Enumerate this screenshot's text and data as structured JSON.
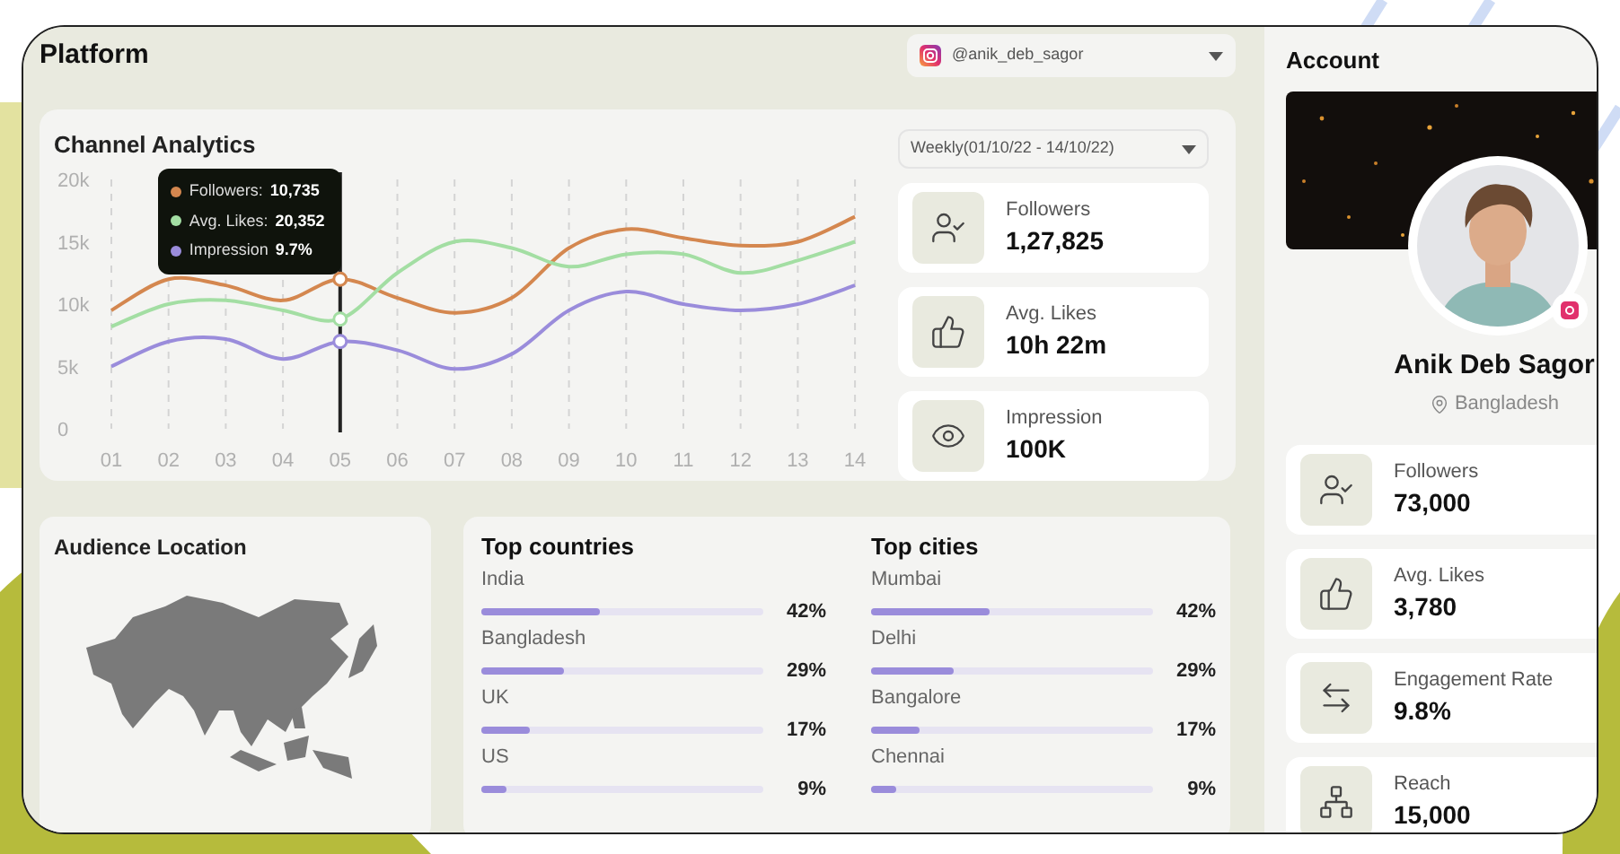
{
  "platform": {
    "title": "Platform",
    "account_select": {
      "value": "@anik_deb_sagor"
    }
  },
  "channel_analytics": {
    "title": "Channel Analytics",
    "period_select": {
      "value": "Weekly(01/10/22 - 14/10/22)"
    },
    "chart_data": {
      "type": "line",
      "grid": true,
      "ref_lines": [
        {
          "axis": "x",
          "value": "05",
          "color": "#222222"
        }
      ],
      "categories": [
        "01",
        "02",
        "03",
        "04",
        "05",
        "06",
        "07",
        "08",
        "09",
        "10",
        "11",
        "12",
        "13",
        "14"
      ],
      "ylim": [
        0,
        20000
      ],
      "yticks": [
        {
          "value": 0,
          "label": "0"
        },
        {
          "value": 5000,
          "label": "5k"
        },
        {
          "value": 10000,
          "label": "10k"
        },
        {
          "value": 15000,
          "label": "15k"
        },
        {
          "value": 20000,
          "label": "20k"
        }
      ],
      "series": [
        {
          "name": "Followers:",
          "color": "#d4874f",
          "values": [
            9500,
            12000,
            11500,
            10300,
            12000,
            10500,
            9300,
            10500,
            14500,
            16000,
            15300,
            14700,
            15000,
            17000
          ]
        },
        {
          "name": "Avg. Likes:",
          "color": "#a3dea3",
          "values": [
            8200,
            10000,
            10300,
            9500,
            8800,
            12500,
            15000,
            14500,
            13000,
            14000,
            14000,
            12500,
            13500,
            15000
          ]
        },
        {
          "name": "Impression",
          "color": "#9a8cdb",
          "values": [
            5000,
            7000,
            7200,
            5600,
            7000,
            6300,
            4800,
            6000,
            9500,
            11000,
            10000,
            9500,
            10000,
            11500
          ]
        }
      ]
    },
    "tooltip": {
      "values": [
        "10,735",
        "20,352",
        "9.7%"
      ]
    },
    "stats": [
      {
        "kind": "followers",
        "label": "Followers",
        "value": "1,27,825"
      },
      {
        "kind": "likes",
        "label": "Avg. Likes",
        "value": "10h 22m"
      },
      {
        "kind": "impression",
        "label": "Impression",
        "value": "100K"
      }
    ]
  },
  "audience_location": {
    "title": "Audience Location"
  },
  "top_countries": {
    "title": "Top countries",
    "items": [
      {
        "name": "India",
        "level": 0.42,
        "percent": "42%"
      },
      {
        "name": "Bangladesh",
        "level": 0.29,
        "percent": "29%"
      },
      {
        "name": "UK",
        "level": 0.17,
        "percent": "17%"
      },
      {
        "name": "US",
        "level": 0.09,
        "percent": "9%"
      }
    ]
  },
  "top_cities": {
    "title": "Top cities",
    "items": [
      {
        "name": "Mumbai",
        "level": 0.42,
        "percent": "42%"
      },
      {
        "name": "Delhi",
        "level": 0.29,
        "percent": "29%"
      },
      {
        "name": "Bangalore",
        "level": 0.17,
        "percent": "17%"
      },
      {
        "name": "Chennai",
        "level": 0.09,
        "percent": "9%"
      }
    ]
  },
  "account": {
    "title": "Account",
    "name": "Anik Deb Sagor",
    "location": "Bangladesh",
    "stats": [
      {
        "kind": "followers",
        "label": "Followers",
        "value": "73,000"
      },
      {
        "kind": "likes",
        "label": "Avg. Likes",
        "value": "3,780"
      },
      {
        "kind": "engagement",
        "label": "Engagement Rate",
        "value": "9.8%"
      },
      {
        "kind": "reach",
        "label": "Reach",
        "value": "15,000"
      }
    ]
  }
}
